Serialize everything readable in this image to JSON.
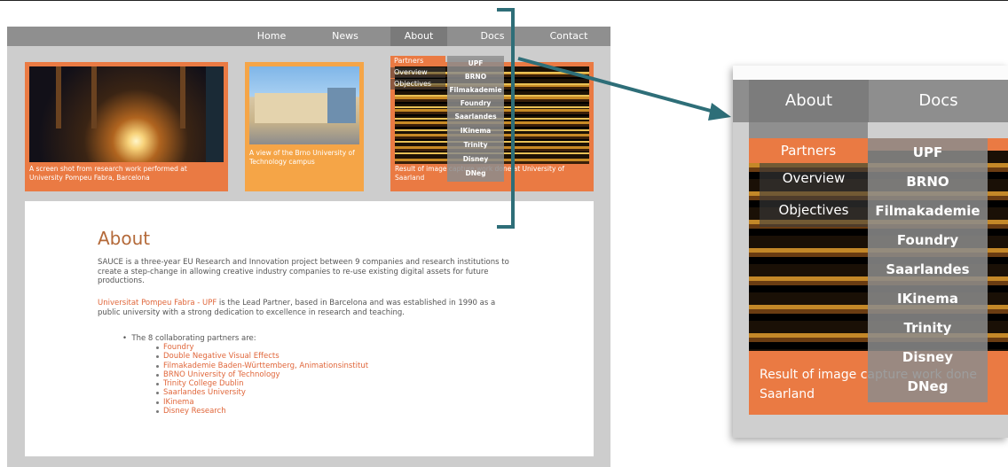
{
  "nav": {
    "items": [
      "Home",
      "News",
      "About",
      "Docs",
      "Contact"
    ],
    "active": "About"
  },
  "cards": [
    {
      "caption": "A screen shot from research work performed at University Pompeu Fabra, Barcelona"
    },
    {
      "caption": "A view of the Brno University of Technology campus"
    },
    {
      "caption": "Result of image capture work done at University of Saarland"
    }
  ],
  "dropdown": {
    "left_items": [
      "Partners",
      "Overview",
      "Objectives"
    ],
    "highlighted": "Partners",
    "right_items": [
      "UPF",
      "BRNO",
      "Filmakademie",
      "Foundry",
      "Saarlandes",
      "IKinema",
      "Trinity",
      "Disney",
      "DNeg"
    ]
  },
  "content": {
    "heading": "About",
    "para1": "SAUCE is a three-year EU Research and Innovation project between 9 companies and research institutions to create a step-change in allowing creative industry companies to re-use existing digital assets for future productions.",
    "para2_link": "Universitat Pompeu Fabra - UPF",
    "para2_text": " is the Lead Partner, based in Barcelona and was established in 1990 as a public university with a strong dedication to excellence in research and teaching.",
    "bullet": "The 8 collaborating partners are:",
    "partners": [
      "Foundry",
      "Double Negative Visual Effects",
      "Filmakademie Baden-Württemberg, Animationsinstitut",
      "BRNO University of Technology",
      "Trinity College Dublin",
      "Saarlandes University",
      "IKinema",
      "Disney Research"
    ]
  },
  "zoom": {
    "nav_about": "About",
    "nav_docs": "Docs",
    "caption_line1": "Result of image capture work done",
    "caption_line2": "Saarland"
  },
  "colors": {
    "accent_orange": "#ea7a43",
    "light_orange": "#f5a547",
    "nav_gray": "#8f8f8f",
    "link": "#e0663a",
    "arrow": "#2e6e78"
  }
}
